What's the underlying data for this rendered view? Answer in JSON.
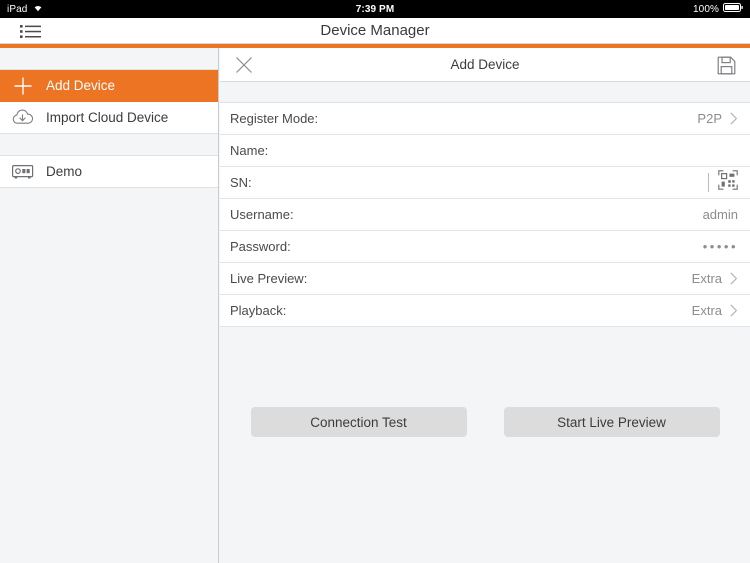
{
  "status_bar": {
    "device_label": "iPad",
    "wifi_icon": "wifi-icon",
    "time": "7:39 PM",
    "battery_percent": "100%",
    "battery_icon": "battery-full-icon"
  },
  "navbar": {
    "menu_icon": "list-menu-icon",
    "title": "Device Manager"
  },
  "theme": {
    "accent": "#ed7423",
    "panel_bg": "#f4f5f7",
    "row_bg": "#ffffff",
    "text": "#3c3c3c",
    "muted_text": "#8b8d91",
    "button_bg": "#dcdcdd"
  },
  "sidebar": {
    "items": [
      {
        "label": "Add Device",
        "icon": "plus-icon",
        "active": true
      },
      {
        "label": "Import Cloud Device",
        "icon": "cloud-download-icon",
        "active": false
      },
      {
        "label": "Demo",
        "icon": "dvr-device-icon",
        "active": false
      }
    ]
  },
  "panel": {
    "close_icon": "close-icon",
    "title": "Add Device",
    "save_icon": "save-floppy-icon",
    "form": [
      {
        "label": "Register Mode:",
        "value": "P2P",
        "accessory": "chevron"
      },
      {
        "label": "Name:",
        "value": "",
        "placeholder": "",
        "accessory": "none"
      },
      {
        "label": "SN:",
        "value": "",
        "placeholder": "",
        "accessory": "qr-scan"
      },
      {
        "label": "Username:",
        "value": "admin",
        "accessory": "none"
      },
      {
        "label": "Password:",
        "value": "•••••",
        "accessory": "none"
      },
      {
        "label": "Live Preview:",
        "value": "Extra",
        "accessory": "chevron"
      },
      {
        "label": "Playback:",
        "value": "Extra",
        "accessory": "chevron"
      }
    ],
    "buttons": [
      {
        "label": "Connection Test"
      },
      {
        "label": "Start Live Preview"
      }
    ]
  }
}
